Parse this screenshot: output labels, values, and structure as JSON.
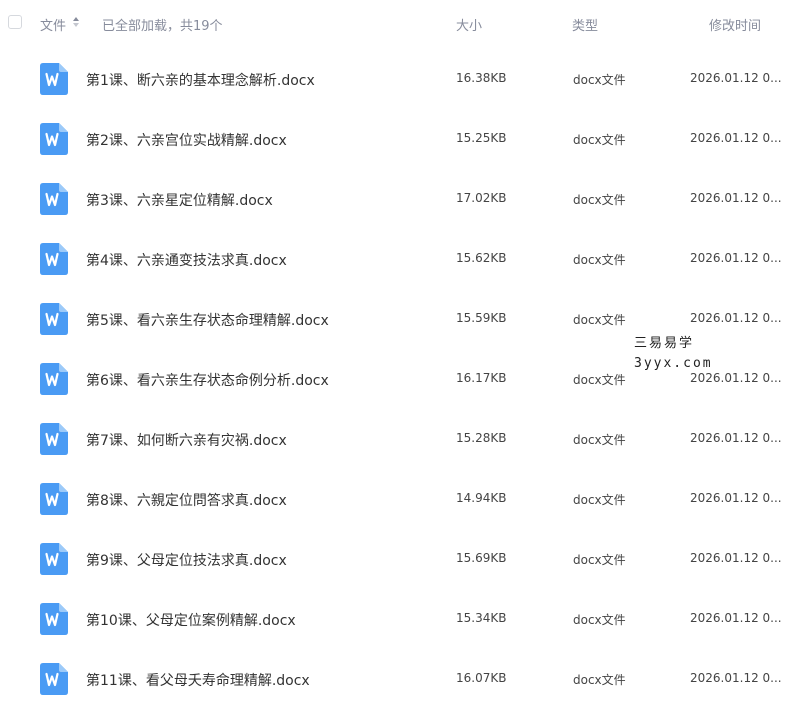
{
  "header": {
    "name_label": "文件",
    "loaded_text": "已全部加载，共19个",
    "size_label": "大小",
    "type_label": "类型",
    "date_label": "修改时间"
  },
  "files": [
    {
      "name": "第1课、断六亲的基本理念解析.docx",
      "size": "16.38KB",
      "type": "docx文件",
      "date": "2026.01.12 0..."
    },
    {
      "name": "第2课、六亲宫位实战精解.docx",
      "size": "15.25KB",
      "type": "docx文件",
      "date": "2026.01.12 0..."
    },
    {
      "name": "第3课、六亲星定位精解.docx",
      "size": "17.02KB",
      "type": "docx文件",
      "date": "2026.01.12 0..."
    },
    {
      "name": "第4课、六亲通变技法求真.docx",
      "size": "15.62KB",
      "type": "docx文件",
      "date": "2026.01.12 0..."
    },
    {
      "name": "第5课、看六亲生存状态命理精解.docx",
      "size": "15.59KB",
      "type": "docx文件",
      "date": "2026.01.12 0..."
    },
    {
      "name": "第6课、看六亲生存状态命例分析.docx",
      "size": "16.17KB",
      "type": "docx文件",
      "date": "2026.01.12 0..."
    },
    {
      "name": "第7课、如何断六亲有灾祸.docx",
      "size": "15.28KB",
      "type": "docx文件",
      "date": "2026.01.12 0..."
    },
    {
      "name": "第8课、六親定位問答求真.docx",
      "size": "14.94KB",
      "type": "docx文件",
      "date": "2026.01.12 0..."
    },
    {
      "name": "第9课、父母定位技法求真.docx",
      "size": "15.69KB",
      "type": "docx文件",
      "date": "2026.01.12 0..."
    },
    {
      "name": "第10课、父母定位案例精解.docx",
      "size": "15.34KB",
      "type": "docx文件",
      "date": "2026.01.12 0..."
    },
    {
      "name": "第11课、看父母夭寿命理精解.docx",
      "size": "16.07KB",
      "type": "docx文件",
      "date": "2026.01.12 0..."
    }
  ],
  "watermark": {
    "line1": "三易易学",
    "line2": "3yyx.com"
  },
  "colors": {
    "icon_blue": "#4a9bf4",
    "header_gray": "#878c9c"
  }
}
